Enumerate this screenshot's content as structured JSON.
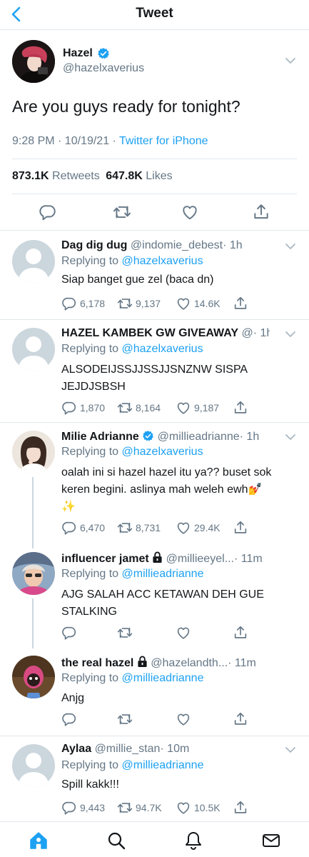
{
  "header": {
    "title": "Tweet"
  },
  "main_tweet": {
    "name": "Hazel",
    "handle": "@hazelxaverius",
    "text": "Are you guys ready for tonight?",
    "time": "9:28 PM · 10/19/21 · ",
    "client": "Twitter for iPhone",
    "retweets_count": "873.1K",
    "retweets_label": "Retweets",
    "likes_count": "647.8K",
    "likes_label": "Likes"
  },
  "replies": [
    {
      "name": "Dag dig dug",
      "handle": "@indomie_debest",
      "time": "· 1h",
      "replying_prefix": "Replying to ",
      "replying_to": "@hazelxaverius",
      "text": "Siap banget gue zel (baca dn)",
      "replies": "6,178",
      "retweets": "9,137",
      "likes": "14.6K"
    },
    {
      "name": "HAZEL KAMBEK GW GIVEAWAY",
      "handle": "@",
      "time": "· 1h",
      "replying_prefix": "Replying to ",
      "replying_to": "@hazelxaverius",
      "text": "ALSODEIJSSJJSSJJSNZNW SISPA JEJDJSBSH",
      "replies": "1,870",
      "retweets": "8,164",
      "likes": "9,187"
    },
    {
      "name": "Milie Adrianne",
      "handle": "@millieadrianne",
      "time": "· 1h",
      "replying_prefix": "Replying to ",
      "replying_to": "@hazelxaverius",
      "text": "oalah ini si hazel hazel itu ya?? buset sok keren begini. aslinya mah weleh ewh💅✨",
      "replies": "6,470",
      "retweets": "8,731",
      "likes": "29.4K"
    },
    {
      "name": "influencer jamet",
      "handle": "@millieeyel...",
      "time": "· 11m",
      "replying_prefix": "Replying to ",
      "replying_to": "@millieadrianne",
      "text": "AJG SALAH ACC KETAWAN DEH GUE STALKING"
    },
    {
      "name": "the real hazel",
      "handle": "@hazelandth...",
      "time": "· 11m",
      "replying_prefix": "Replying to ",
      "replying_to": "@millieadrianne",
      "text": "Anjg"
    },
    {
      "name": "Aylaa",
      "handle": "@millie_stan",
      "time": "· 10m",
      "replying_prefix": "Replying to ",
      "replying_to": "@millieadrianne",
      "text": "Spill kakk!!!",
      "replies": "9,443",
      "retweets": "94.7K",
      "likes": "10.5K"
    }
  ],
  "icons": [
    "back-chevron-icon",
    "verified-badge-icon",
    "chevron-down-icon",
    "reply-icon",
    "retweet-icon",
    "like-icon",
    "share-icon",
    "lock-icon",
    "home-icon",
    "search-icon",
    "notifications-icon",
    "messages-icon"
  ],
  "colors": {
    "accent": "#1da1f2",
    "text": "#14171a",
    "secondary": "#657786",
    "divider": "#e1e8ed"
  }
}
